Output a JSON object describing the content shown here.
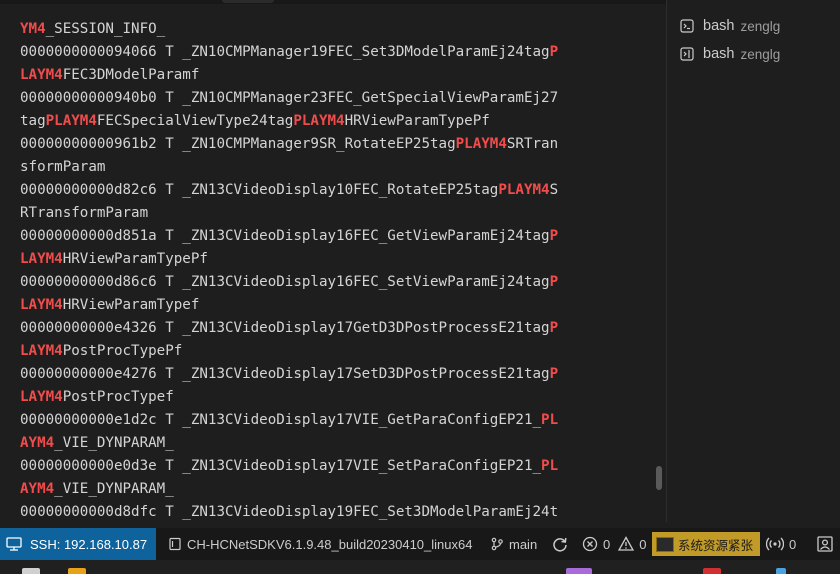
{
  "terminal": {
    "lines": [
      [
        {
          "t": "YM4",
          "h": true
        },
        {
          "t": "_SESSION_INFO_",
          "h": false
        }
      ],
      [
        {
          "t": "0000000000094066 T _ZN10CMPManager19FEC_Set3DModelParamEj24tag",
          "h": false
        },
        {
          "t": "P",
          "h": true
        }
      ],
      [
        {
          "t": "LAYM4",
          "h": true
        },
        {
          "t": "FEC3DModelParamf",
          "h": false
        }
      ],
      [
        {
          "t": "00000000000940b0 T _ZN10CMPManager23FEC_GetSpecialViewParamEj27",
          "h": false
        }
      ],
      [
        {
          "t": "tag",
          "h": false
        },
        {
          "t": "PLAYM4",
          "h": true
        },
        {
          "t": "FECSpecialViewType24tag",
          "h": false
        },
        {
          "t": "PLAYM4",
          "h": true
        },
        {
          "t": "HRViewParamTypePf",
          "h": false
        }
      ],
      [
        {
          "t": "00000000000961b2 T _ZN10CMPManager9SR_RotateEP25tag",
          "h": false
        },
        {
          "t": "PLAYM4",
          "h": true
        },
        {
          "t": "SRTran",
          "h": false
        }
      ],
      [
        {
          "t": "sformParam",
          "h": false
        }
      ],
      [
        {
          "t": "00000000000d82c6 T _ZN13CVideoDisplay10FEC_RotateEP25tag",
          "h": false
        },
        {
          "t": "PLAYM4",
          "h": true
        },
        {
          "t": "S",
          "h": false
        }
      ],
      [
        {
          "t": "RTransformParam",
          "h": false
        }
      ],
      [
        {
          "t": "00000000000d851a T _ZN13CVideoDisplay16FEC_GetViewParamEj24tag",
          "h": false
        },
        {
          "t": "P",
          "h": true
        }
      ],
      [
        {
          "t": "LAYM4",
          "h": true
        },
        {
          "t": "HRViewParamTypePf",
          "h": false
        }
      ],
      [
        {
          "t": "00000000000d86c6 T _ZN13CVideoDisplay16FEC_SetViewParamEj24tag",
          "h": false
        },
        {
          "t": "P",
          "h": true
        }
      ],
      [
        {
          "t": "LAYM4",
          "h": true
        },
        {
          "t": "HRViewParamTypef",
          "h": false
        }
      ],
      [
        {
          "t": "00000000000e4326 T _ZN13CVideoDisplay17GetD3DPostProcessE21tag",
          "h": false
        },
        {
          "t": "P",
          "h": true
        }
      ],
      [
        {
          "t": "LAYM4",
          "h": true
        },
        {
          "t": "PostProcTypePf",
          "h": false
        }
      ],
      [
        {
          "t": "00000000000e4276 T _ZN13CVideoDisplay17SetD3DPostProcessE21tag",
          "h": false
        },
        {
          "t": "P",
          "h": true
        }
      ],
      [
        {
          "t": "LAYM4",
          "h": true
        },
        {
          "t": "PostProcTypef",
          "h": false
        }
      ],
      [
        {
          "t": "00000000000e1d2c T _ZN13CVideoDisplay17VIE_GetParaConfigEP21_",
          "h": false
        },
        {
          "t": "PL",
          "h": true
        }
      ],
      [
        {
          "t": "AYM4",
          "h": true
        },
        {
          "t": "_VIE_DYNPARAM_",
          "h": false
        }
      ],
      [
        {
          "t": "00000000000e0d3e T _ZN13CVideoDisplay17VIE_SetParaConfigEP21_",
          "h": false
        },
        {
          "t": "PL",
          "h": true
        }
      ],
      [
        {
          "t": "AYM4",
          "h": true
        },
        {
          "t": "_VIE_DYNPARAM_",
          "h": false
        }
      ],
      [
        {
          "t": "00000000000d8dfc T _ZN13CVideoDisplay19FEC_Set3DModelParamEj24t",
          "h": false
        }
      ]
    ]
  },
  "terminal_list": [
    {
      "name": "bash",
      "sub": "zenglg",
      "icon": "terminal-icon"
    },
    {
      "name": "bash",
      "sub": "zenglg",
      "icon": "terminal-split-icon"
    }
  ],
  "status": {
    "remote": "SSH: 192.168.10.87",
    "folder": "CH-HCNetSDKV6.1.9.48_build20230410_linux64",
    "branch": "main",
    "errors": "0",
    "warnings": "0",
    "extension": "系统资源紧张",
    "ports": "0"
  },
  "colors": {
    "terminal_bg": "#1e1e1e",
    "terminal_text": "#d4d4d4",
    "highlight": "#f14c4c",
    "remote_bg": "#0e639c",
    "warning_chip": "#c19a28"
  }
}
